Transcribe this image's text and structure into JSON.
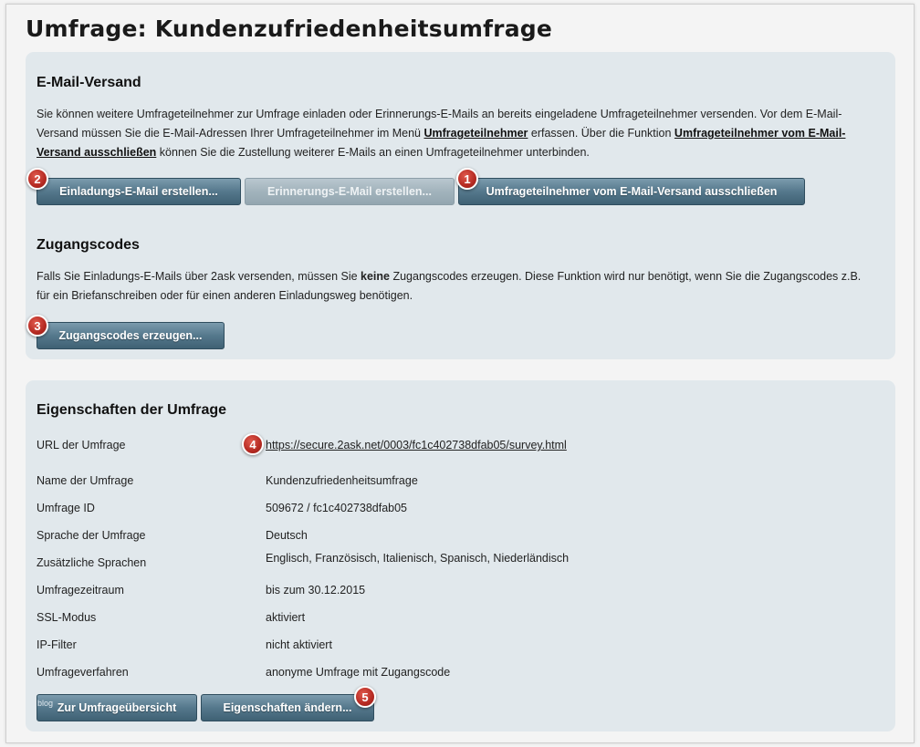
{
  "page": {
    "title": "Umfrage: Kundenzufriedenheitsumfrage"
  },
  "email": {
    "heading": "E-Mail-Versand",
    "text_1": "Sie können weitere Umfrageteilnehmer zur Umfrage einladen oder Erinnerungs-E-Mails an bereits eingeladene Umfrageteilnehmer versenden. Vor dem E-Mail-Versand müssen Sie die E-Mail-Adressen Ihrer Umfrageteilnehmer im Menü ",
    "link_participants": "Umfrageteilnehmer",
    "text_2": " erfassen. Über die Funktion ",
    "link_exclude": "Umfrageteilnehmer vom E-Mail-Versand ausschließen",
    "text_3": " können Sie die Zustellung weiterer E-Mails an einen Umfrageteilnehmer unterbinden.",
    "btn_invite": "Einladungs-E-Mail erstellen...",
    "btn_reminder": "Erinnerungs-E-Mail erstellen...",
    "btn_exclude": "Umfrageteilnehmer vom E-Mail-Versand ausschließen"
  },
  "codes": {
    "heading": "Zugangscodes",
    "text_1": "Falls Sie Einladungs-E-Mails über 2ask versenden, müssen Sie ",
    "text_bold": "keine",
    "text_2": " Zugangscodes erzeugen. Diese Funktion wird nur benötigt, wenn Sie die Zugangscodes z.B. für ein Briefanschreiben oder für einen anderen Einladungsweg benötigen.",
    "btn_generate": "Zugangscodes erzeugen..."
  },
  "props": {
    "heading": "Eigenschaften der Umfrage",
    "rows": [
      {
        "label": "URL der Umfrage",
        "value": "https://secure.2ask.net/0003/fc1c402738dfab05/survey.html"
      },
      {
        "label": "Name der Umfrage",
        "value": "Kundenzufriedenheitsumfrage"
      },
      {
        "label": "Umfrage ID",
        "value": "509672 / fc1c402738dfab05"
      },
      {
        "label": "Sprache der Umfrage",
        "value": "Deutsch"
      },
      {
        "label": "Zusätzliche Sprachen",
        "value": "Englisch, Französisch, Italienisch, Spanisch, Niederländisch"
      },
      {
        "label": "Umfragezeitraum",
        "value": "bis zum 30.12.2015"
      },
      {
        "label": "SSL-Modus",
        "value": "aktiviert"
      },
      {
        "label": "IP-Filter",
        "value": "nicht aktiviert"
      },
      {
        "label": "Umfrageverfahren",
        "value": "anonyme Umfrage mit Zugangscode"
      }
    ],
    "btn_overview_prefix": "blog",
    "btn_overview": "Zur Umfrageübersicht",
    "btn_edit": "Eigenschaften ändern..."
  },
  "badges": {
    "b1": "1",
    "b2": "2",
    "b3": "3",
    "b4": "4",
    "b5": "5"
  },
  "colors": {
    "panel": "#e1e8ec",
    "button": "#55788c",
    "badge": "#b52a22"
  }
}
